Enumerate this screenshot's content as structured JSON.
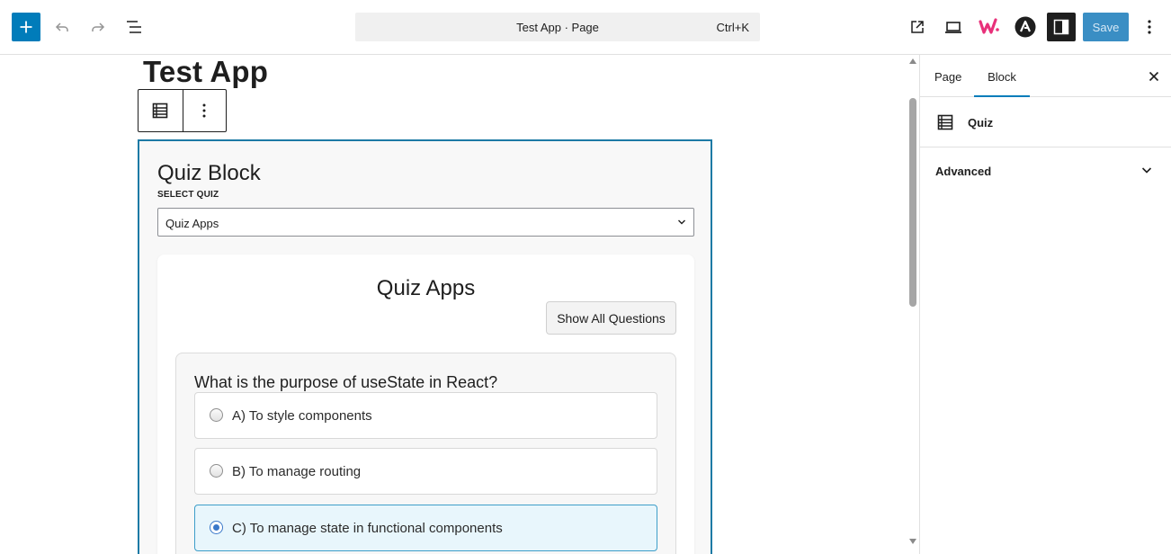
{
  "header": {
    "add_icon": "plus-icon",
    "undo_icon": "undo-icon",
    "redo_icon": "redo-icon",
    "list_view_icon": "list-view-icon",
    "command_title": "Test App · Page",
    "command_shortcut": "Ctrl+K",
    "view_icon": "external-link-icon",
    "preview_icon": "laptop-icon",
    "plugin_icon_w": "w-logo-icon",
    "plugin_icon_a": "astra-logo-icon",
    "settings_icon": "sidebar-toggle-icon",
    "save_label": "Save",
    "options_icon": "more-vertical-icon",
    "colors": {
      "accent": "#007cba",
      "save_bg": "#3a8ec4",
      "w_logo": "#e8317a"
    }
  },
  "canvas": {
    "page_title": "Test App",
    "block_toolbar": {
      "block_icon": "table-list-icon",
      "options_icon": "more-vertical-icon"
    },
    "quiz_block": {
      "title": "Quiz Block",
      "select_label": "SELECT QUIZ",
      "select_value": "Quiz Apps",
      "quiz": {
        "title": "Quiz Apps",
        "show_all_label": "Show All Questions",
        "question": "What is the purpose of useState in React?",
        "options": [
          {
            "label": "A) To style components",
            "selected": false
          },
          {
            "label": "B) To manage routing",
            "selected": false
          },
          {
            "label": "C) To manage state in functional components",
            "selected": true
          }
        ]
      },
      "border_color": "#1d7aa5"
    }
  },
  "sidebar": {
    "tabs": [
      {
        "label": "Page",
        "active": false
      },
      {
        "label": "Block",
        "active": true
      }
    ],
    "close_icon": "close-icon",
    "block_name": "Quiz",
    "block_icon": "table-list-icon",
    "panels": [
      {
        "label": "Advanced",
        "expanded": false
      }
    ]
  }
}
